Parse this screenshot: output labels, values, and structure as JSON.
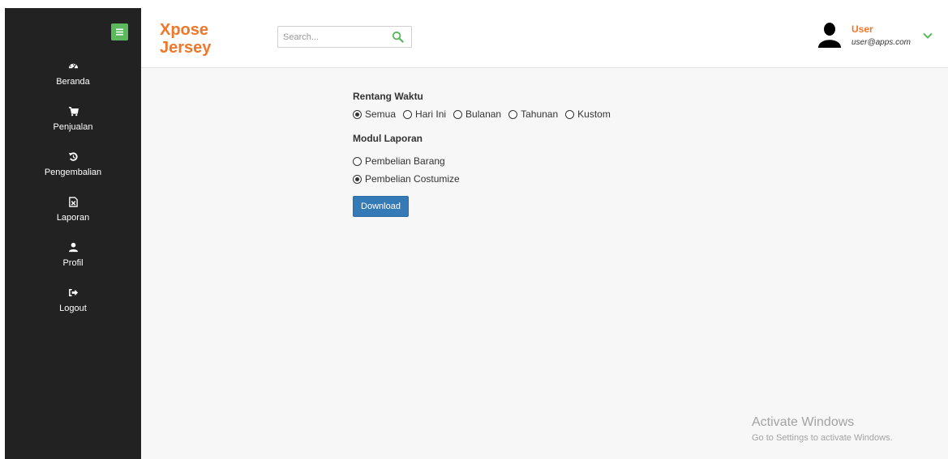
{
  "sidebar": {
    "items": [
      {
        "label": "Beranda",
        "icon": "dashboard-icon"
      },
      {
        "label": "Penjualan",
        "icon": "cart-icon"
      },
      {
        "label": "Pengembalian",
        "icon": "undo-icon"
      },
      {
        "label": "Laporan",
        "icon": "excel-file-icon"
      },
      {
        "label": "Profil",
        "icon": "user-icon"
      },
      {
        "label": "Logout",
        "icon": "logout-icon"
      }
    ]
  },
  "header": {
    "brand_line1": "Xpose",
    "brand_line2": "Jersey",
    "search_placeholder": "Search...",
    "user_name": "User",
    "user_email": "user@apps.com"
  },
  "report": {
    "range_title": "Rentang Waktu",
    "range_options": [
      "Semua",
      "Hari Ini",
      "Bulanan",
      "Tahunan",
      "Kustom"
    ],
    "range_selected": "Semua",
    "module_title": "Modul Laporan",
    "module_options": [
      "Pembelian Barang",
      "Pembelian Costumize"
    ],
    "module_selected": "Pembelian Costumize",
    "download_label": "Download"
  },
  "watermark": {
    "line1": "Activate Windows",
    "line2": "Go to Settings to activate Windows."
  },
  "colors": {
    "sidebar_bg": "#222222",
    "brand": "#f0772a",
    "accent_green": "#5cb85c",
    "button_blue": "#337ab7"
  }
}
